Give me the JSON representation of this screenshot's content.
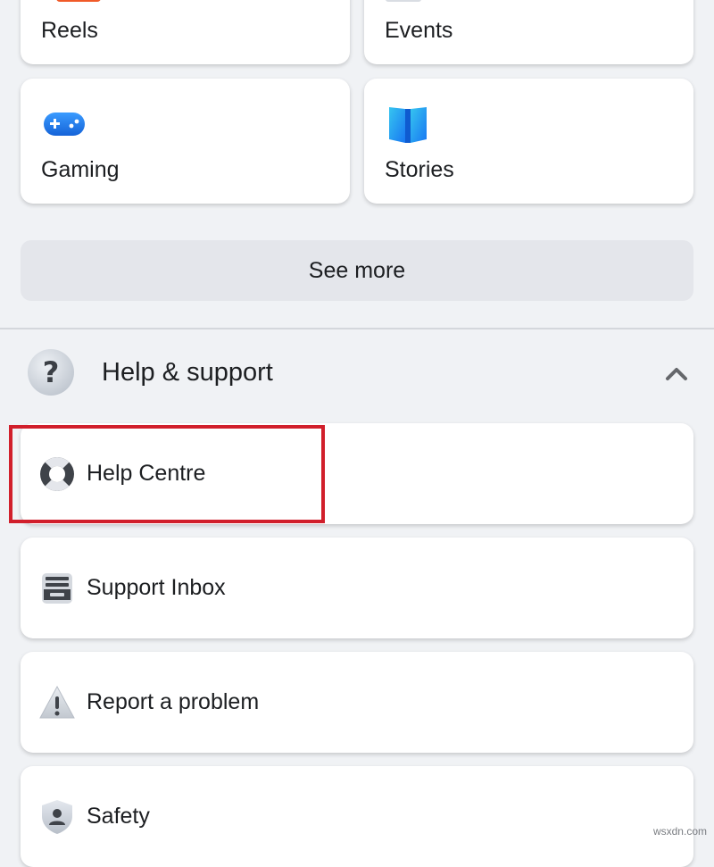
{
  "shortcuts": [
    {
      "label": "Reels",
      "icon": "reels-icon"
    },
    {
      "label": "Events",
      "icon": "events-icon"
    },
    {
      "label": "Gaming",
      "icon": "gaming-controller-icon"
    },
    {
      "label": "Stories",
      "icon": "stories-book-icon"
    }
  ],
  "see_more_label": "See more",
  "help_section": {
    "title": "Help & support",
    "icon": "question-mark-icon",
    "expanded": true,
    "items": [
      {
        "label": "Help Centre",
        "icon": "lifebuoy-icon",
        "highlighted": true
      },
      {
        "label": "Support Inbox",
        "icon": "inbox-tray-icon"
      },
      {
        "label": "Report a problem",
        "icon": "warning-triangle-icon"
      },
      {
        "label": "Safety",
        "icon": "shield-person-icon"
      }
    ]
  },
  "colors": {
    "background": "#f0f2f5",
    "card": "#ffffff",
    "highlight": "#d11f2b",
    "gaming_blue": "#1877f2"
  },
  "watermark": "wsxdn.com"
}
